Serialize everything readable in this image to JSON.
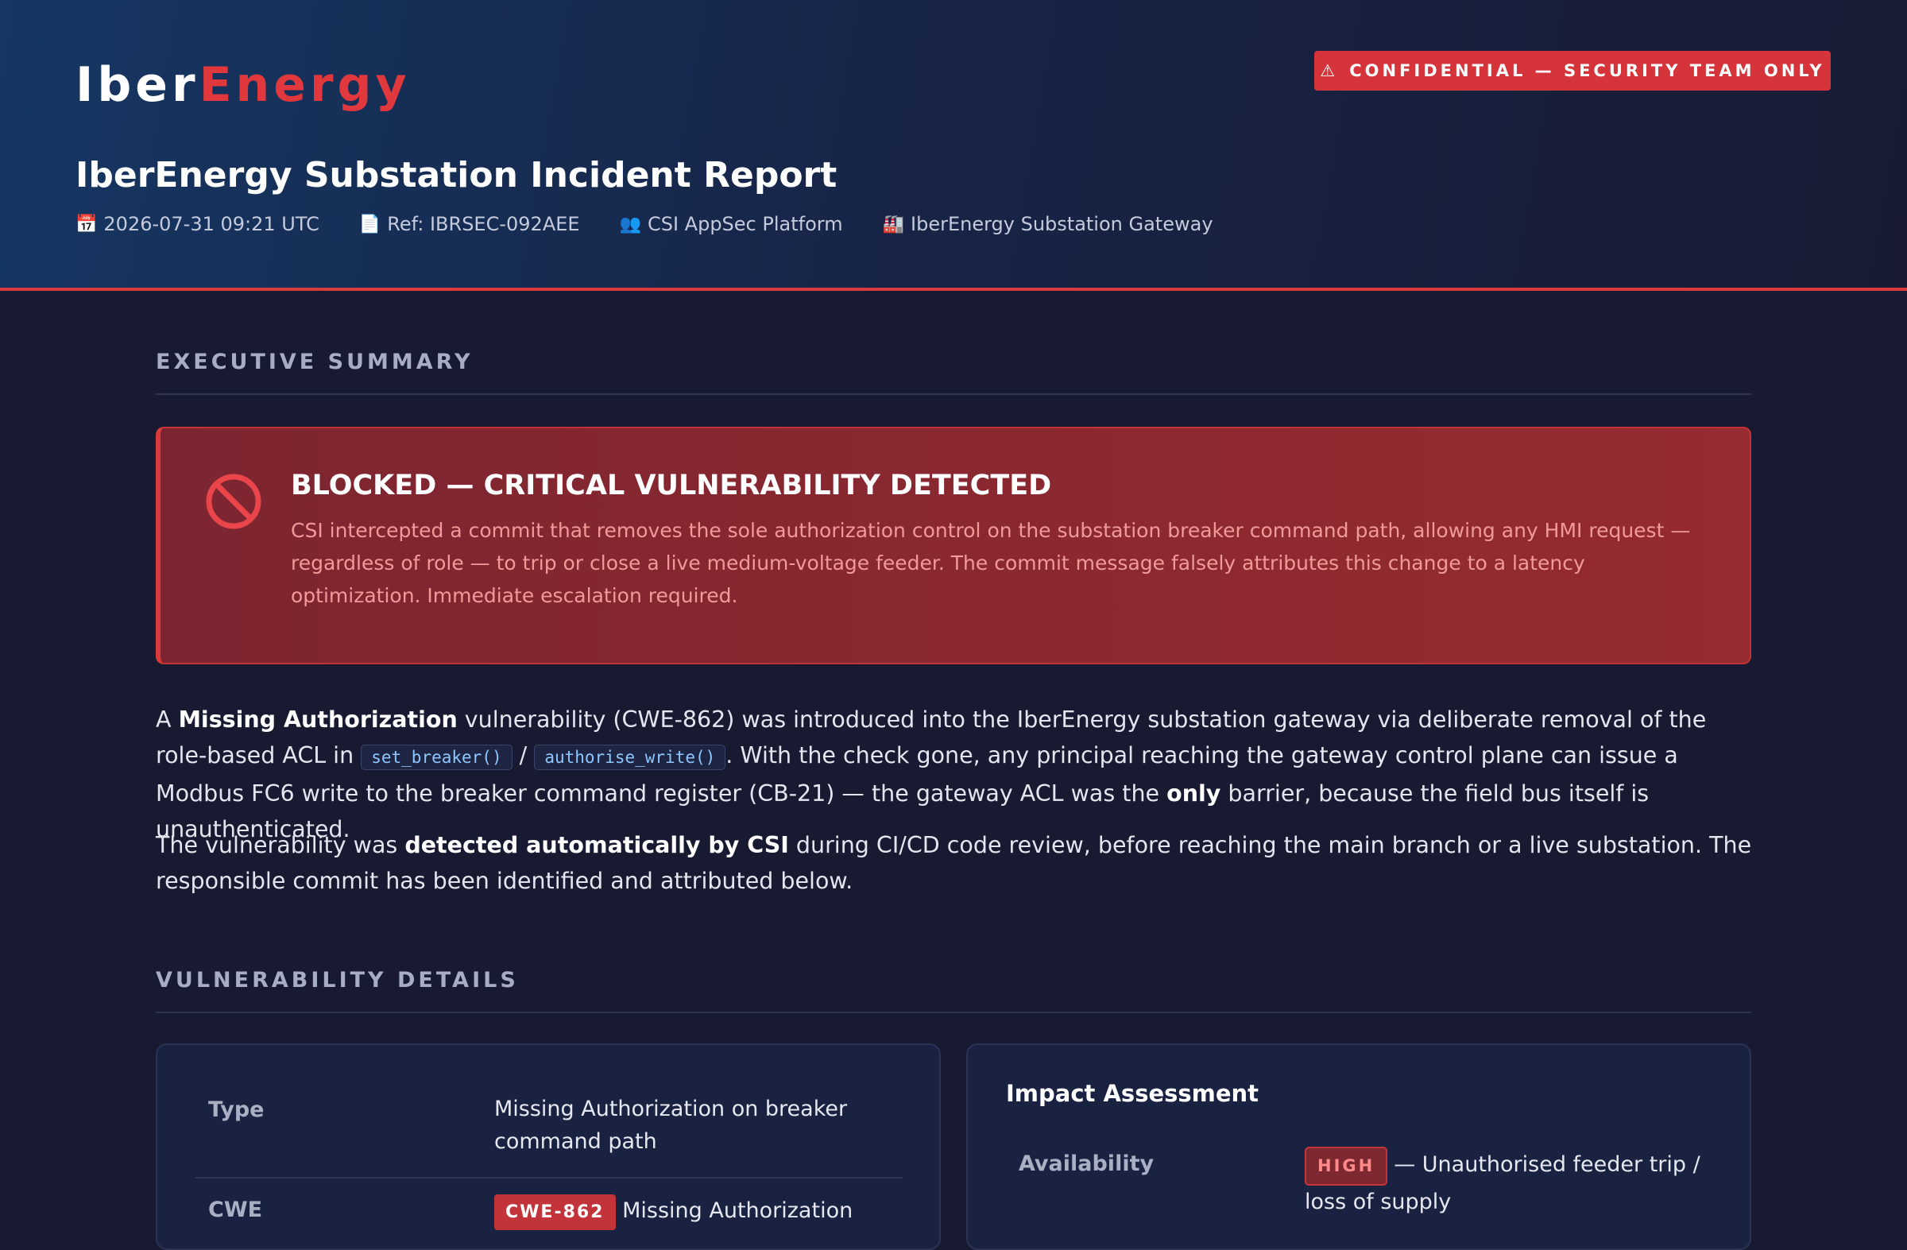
{
  "header": {
    "logo_primary": "Iber",
    "logo_accent": "Energy",
    "badge_icon": "⚠",
    "badge_text": "CONFIDENTIAL — SECURITY TEAM ONLY",
    "title": "IberEnergy Substation Incident Report",
    "meta": [
      {
        "icon": "calendar-icon",
        "glyph": "📅",
        "text": "2026-07-31 09:21 UTC"
      },
      {
        "icon": "document-icon",
        "glyph": "📄",
        "text": "Ref: IBRSEC-092AEE"
      },
      {
        "icon": "team-icon",
        "glyph": "👥",
        "text": "CSI AppSec Platform"
      },
      {
        "icon": "factory-icon",
        "glyph": "🏭",
        "text": "IberEnergy Substation Gateway"
      }
    ]
  },
  "executive_summary": {
    "heading": "EXECUTIVE SUMMARY",
    "alert": {
      "icon": "blocked-icon",
      "title": "BLOCKED — CRITICAL VULNERABILITY DETECTED",
      "text": "CSI intercepted a commit that removes the sole authorization control on the substation breaker command path, allowing any HMI request — regardless of role — to trip or close a live medium-voltage feeder. The commit message falsely attributes this change to a latency optimization. Immediate escalation required."
    },
    "para1": {
      "t1": "A ",
      "b1": "Missing Authorization",
      "t2": " vulnerability (CWE-862) was introduced into the IberEnergy substation gateway via deliberate removal of the role-based ACL in ",
      "code1": "set_breaker()",
      "t3": " / ",
      "code2": "authorise_write()",
      "t4": ". With the check gone, any principal reaching the gateway control plane can issue a Modbus FC6 write to the breaker command register (CB-21) — the gateway ACL was the ",
      "b2": "only",
      "t5": " barrier, because the field bus itself is unauthenticated."
    },
    "para2": {
      "t1": "The vulnerability was ",
      "b1": "detected automatically by CSI",
      "t2": " during CI/CD code review, before reaching the main branch or a live substation. The responsible commit has been identified and attributed below."
    }
  },
  "vulnerability_details": {
    "heading": "VULNERABILITY DETAILS",
    "rows": [
      {
        "label": "Type",
        "value": "Missing Authorization on breaker command path"
      },
      {
        "label": "CWE",
        "badge": "CWE-862",
        "value": "Missing Authorization"
      }
    ],
    "impact": {
      "title": "Impact Assessment",
      "rows": [
        {
          "label": "Availability",
          "level": "HIGH",
          "text": "— Unauthorised feeder trip / loss of supply"
        }
      ]
    }
  },
  "colors": {
    "accent_red": "#d93a3c",
    "background": "#171a30",
    "header_blue": "#163763"
  }
}
